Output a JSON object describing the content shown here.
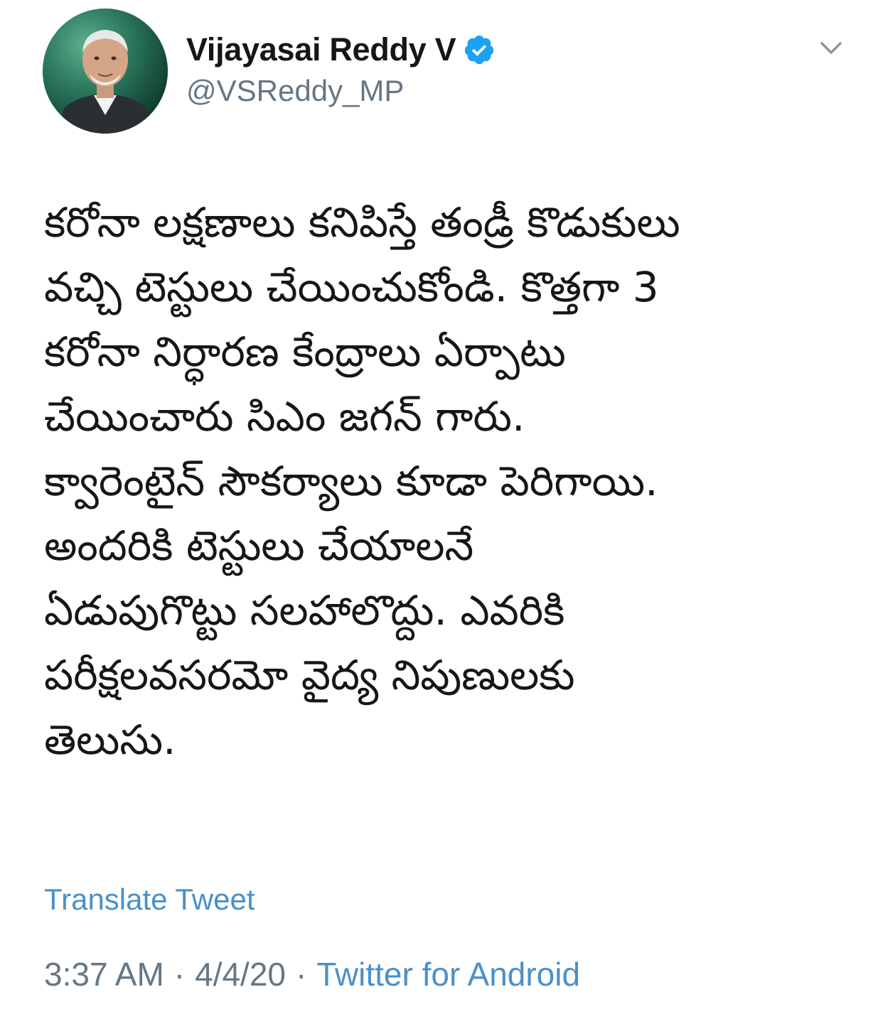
{
  "author": {
    "display_name": "Vijayasai Reddy V",
    "handle": "@VSReddy_MP",
    "verified": true,
    "avatar_icon": "profile-photo"
  },
  "menu": {
    "icon": "chevron-down-icon"
  },
  "tweet": {
    "lines": [
      "కరోనా లక్షణాలు కనిపిస్తే తండ్రీ కొడుకులు",
      "వచ్చి టెస్టులు చేయించుకోండి. కొత్తగా 3",
      "కరోనా నిర్ధారణ కేంద్రాలు ఏర్పాటు",
      "చేయించారు సిఎం జగన్ గారు.",
      "క్వారెంటైన్ సౌకర్యాలు కూడా పెరిగాయి.",
      "అందరికి టెస్టులు చేయాలనే",
      "ఏడుపుగొట్టు సలహాలొద్దు. ఎవరికి",
      "పరీక్షలవసరమో వైద్య నిపుణులకు",
      "తెలుసు."
    ]
  },
  "translate_label": "Translate Tweet",
  "meta": {
    "time": "3:37 AM",
    "date": "4/4/20",
    "separator": "·",
    "source": "Twitter for Android"
  },
  "colors": {
    "link": "#4a90c9",
    "secondary_text": "#657786",
    "verified_badge": "#1da1f2"
  }
}
